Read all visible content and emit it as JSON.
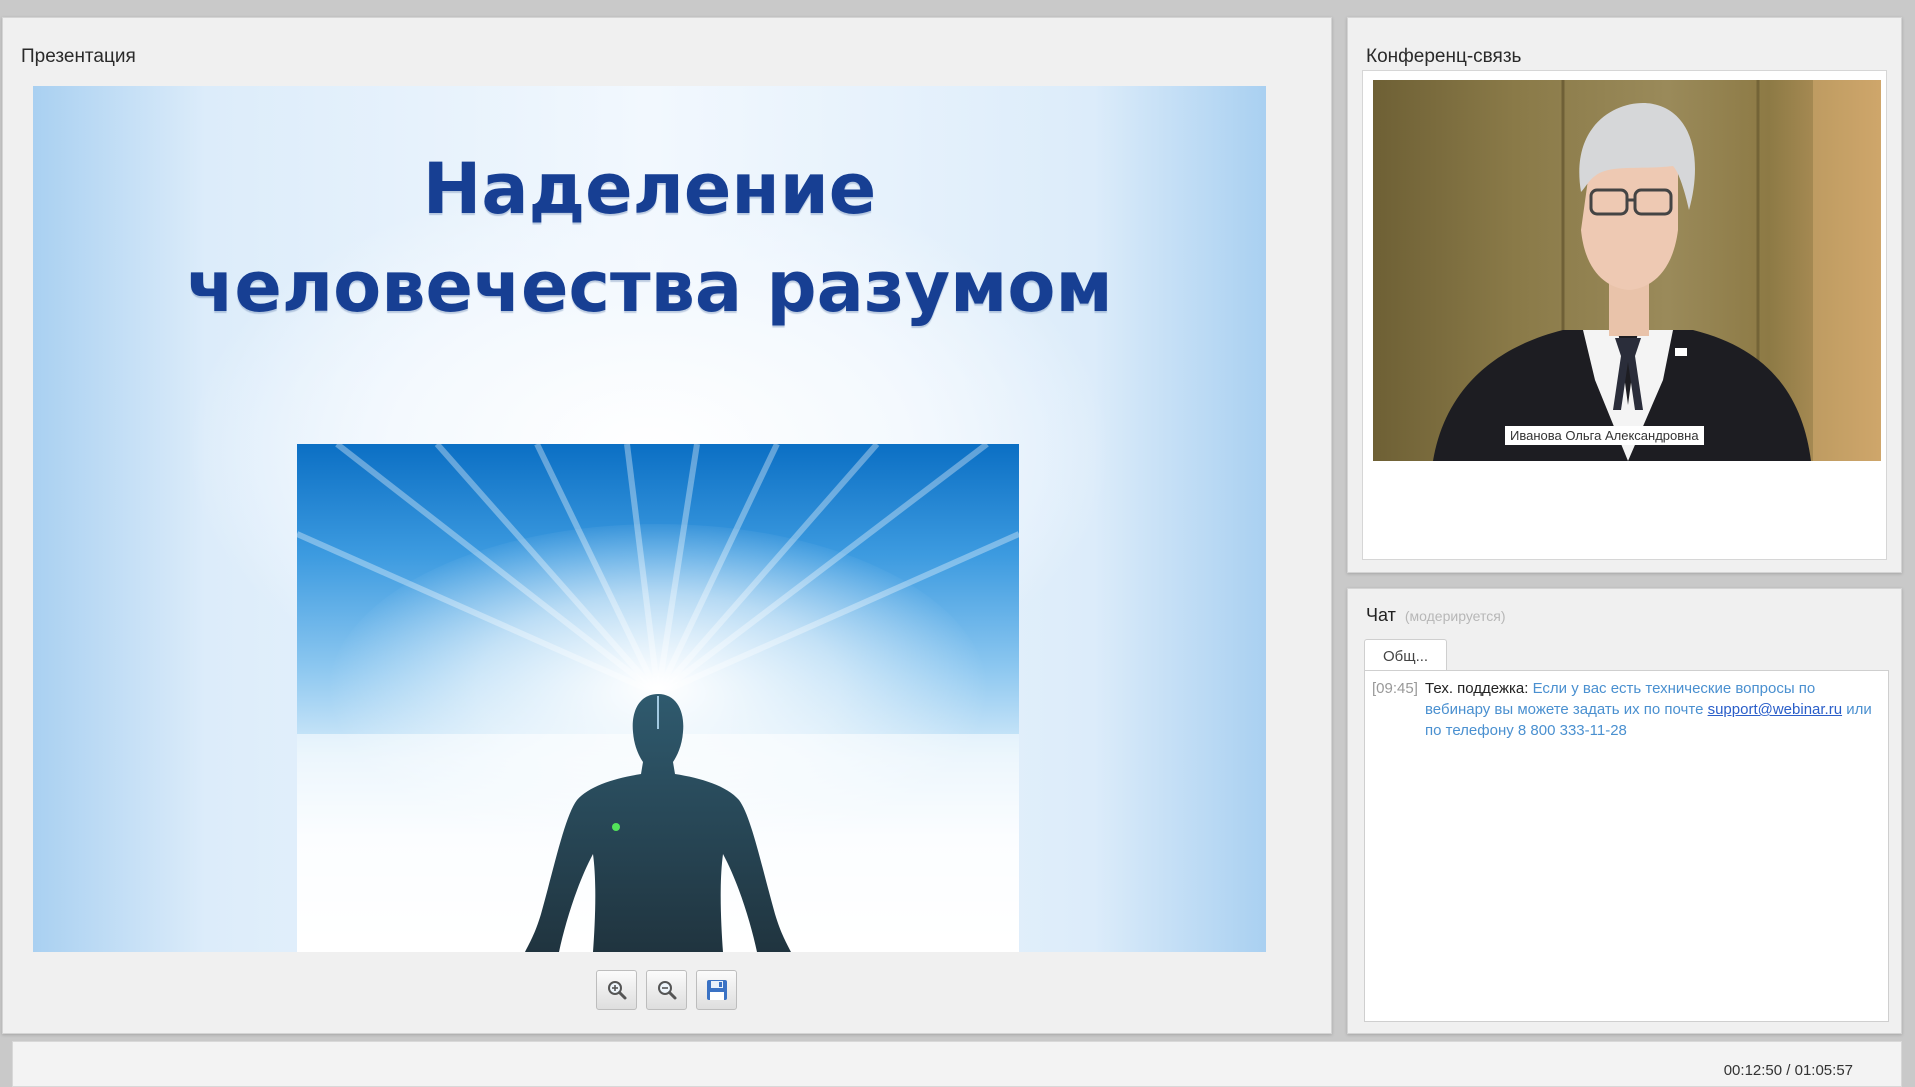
{
  "presentation": {
    "title": "Презентация",
    "slide": {
      "title_line_1": "Наделение",
      "title_line_2": "человечества разумом"
    },
    "toolbar": {
      "zoom_in_icon": "zoom-in-icon",
      "zoom_out_icon": "zoom-out-icon",
      "save_icon": "save-icon"
    }
  },
  "conference": {
    "title": "Конференц-связь",
    "speaker_name": "Иванова Ольга Александровна"
  },
  "chat": {
    "title": "Чат",
    "moderated_note": "(модерируется)",
    "tab_label": "Общ...",
    "messages": [
      {
        "time": "[09:45]",
        "author": "Тех. поддежка:",
        "text": "Если у вас есть технические вопросы по вебинару вы можете задать их по почте",
        "email": "support@webinar.ru",
        "text_after": "или по телефону 8 800 333-11-28"
      }
    ]
  },
  "player": {
    "time": "00:12:50 / 01:05:57"
  },
  "colors": {
    "slide_title": "#173f93",
    "chat_message": "#4a90d0",
    "chat_link": "#2a5ec9",
    "panel_background": "#f0f0f0"
  }
}
